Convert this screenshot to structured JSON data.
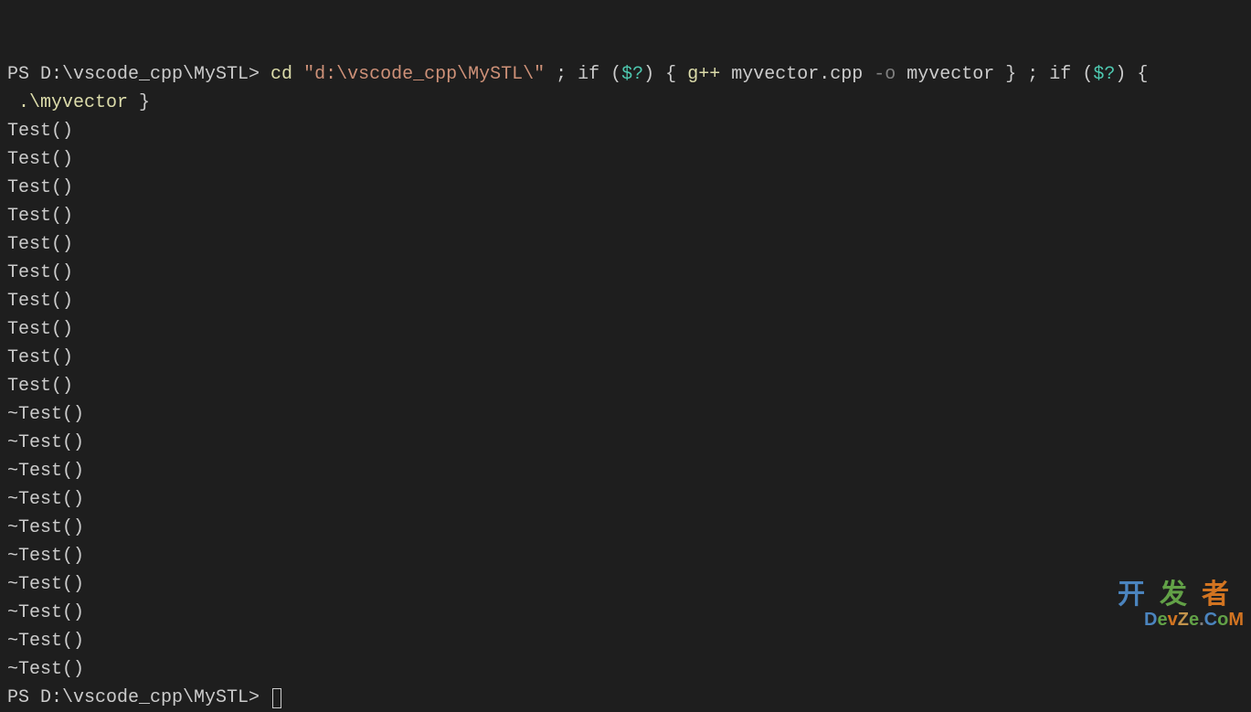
{
  "terminal": {
    "prompt1_prefix": "PS D:\\vscode_cpp\\MySTL> ",
    "cmd_cd": "cd ",
    "cmd_path": "\"d:\\vscode_cpp\\MySTL\\\"",
    "cmd_sep1": " ; ",
    "cmd_if1": "if",
    "cmd_paren1": " (",
    "cmd_var1": "$?",
    "cmd_paren2": ") { ",
    "cmd_gpp": "g++",
    "cmd_src": " myvector.cpp",
    "cmd_flag": " -o",
    "cmd_out": " myvector",
    "cmd_close1": " } ; ",
    "cmd_if2": "if",
    "cmd_paren3": " (",
    "cmd_var2": "$?",
    "cmd_paren4": ") {",
    "cmd_line2_prefix": " ",
    "cmd_exec": ".\\myvector",
    "cmd_close2": " }",
    "output": [
      "Test()",
      "Test()",
      "Test()",
      "Test()",
      "Test()",
      "Test()",
      "Test()",
      "Test()",
      "Test()",
      "Test()",
      "~Test()",
      "~Test()",
      "~Test()",
      "~Test()",
      "~Test()",
      "~Test()",
      "~Test()",
      "~Test()",
      "~Test()",
      "~Test()"
    ],
    "prompt2": "PS D:\\vscode_cpp\\MySTL> "
  },
  "watermark": {
    "cn1": "开",
    "cn2": "发",
    "cn3": "者",
    "en": "DevZe.CoM"
  }
}
